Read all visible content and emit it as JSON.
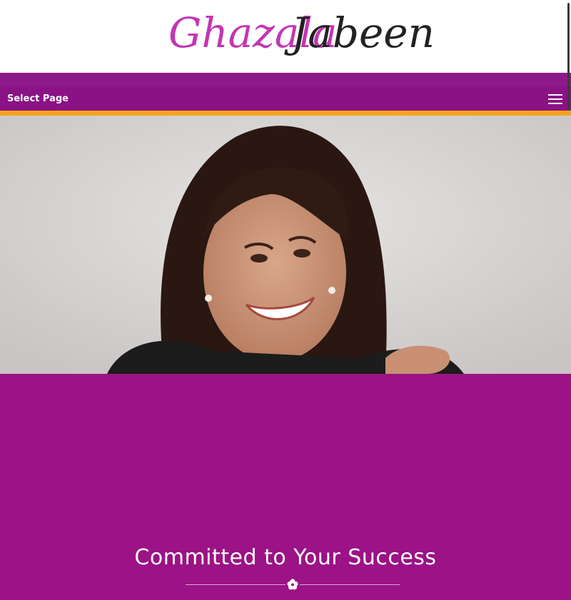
{
  "header": {
    "logo_first": "Ghazala",
    "logo_last": "Jabeen"
  },
  "nav": {
    "label": "Select Page",
    "menu_icon": "hamburger-menu-icon"
  },
  "hero": {
    "image_description": "portrait-photo"
  },
  "section": {
    "headline": "Committed to Your Success",
    "divider_icon": "flower-icon"
  },
  "colors": {
    "brand_purple": "#9b1386",
    "nav_purple": "#8a1285",
    "accent_orange": "#f3a41a",
    "logo_pink": "#c236b4",
    "logo_dark": "#222222"
  }
}
